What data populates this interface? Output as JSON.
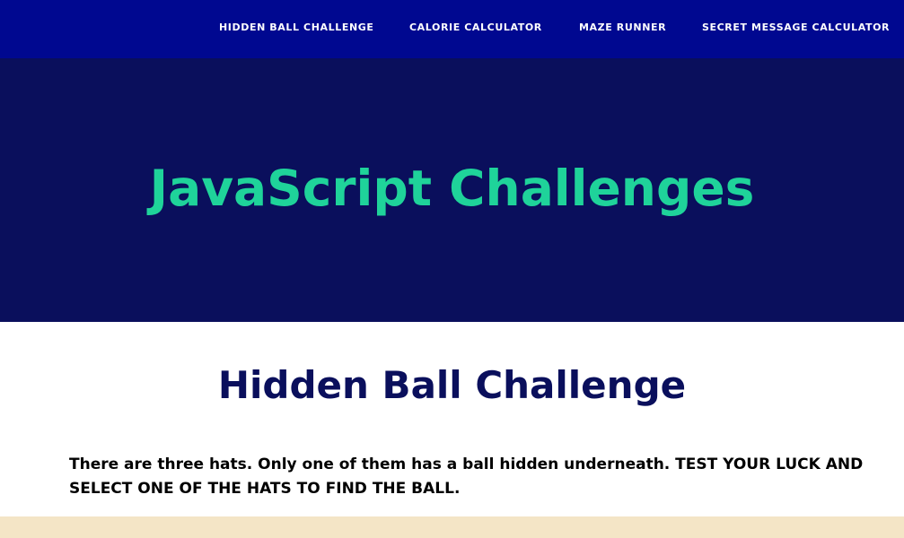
{
  "nav": {
    "items": [
      {
        "label": "HIDDEN BALL CHALLENGE"
      },
      {
        "label": "CALORIE CALCULATOR"
      },
      {
        "label": "MAZE RUNNER"
      },
      {
        "label": "SECRET MESSAGE CALCULATOR"
      }
    ]
  },
  "hero": {
    "title": "JavaScript Challenges"
  },
  "challenge": {
    "title": "Hidden Ball Challenge",
    "description": "There are three hats. Only one of them has a ball hidden underneath. TEST YOUR LUCK AND SELECT ONE OF THE HATS TO FIND THE BALL."
  },
  "colors": {
    "nav_background": "#000890",
    "hero_background": "#0a0f5c",
    "hero_title": "#1fd39a",
    "section_title": "#0a0f5c",
    "bottom_band": "#f4e5c6"
  }
}
